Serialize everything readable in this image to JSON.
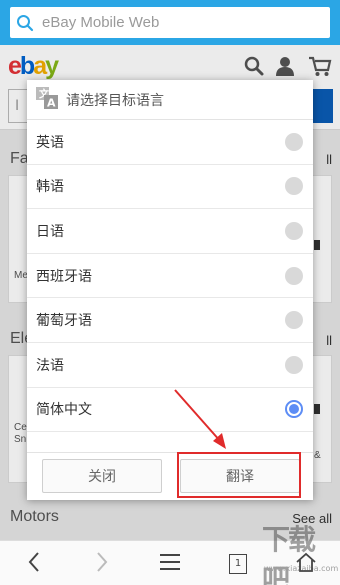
{
  "browser": {
    "url_text": "eBay Mobile Web",
    "accent_color": "#2ba6e5"
  },
  "ebay": {
    "logo_letters": [
      "e",
      "b",
      "a",
      "y"
    ],
    "search_placeholder": "I"
  },
  "background": {
    "sections": [
      "Fa",
      "Ele",
      "Motors"
    ],
    "see_all": [
      "ll",
      "ll",
      "See all"
    ],
    "card_labels": [
      "Me",
      "Ce",
      "Sn",
      "&"
    ]
  },
  "dialog": {
    "title": "请选择目标语言",
    "languages": [
      {
        "label": "英语",
        "selected": false
      },
      {
        "label": "韩语",
        "selected": false
      },
      {
        "label": "日语",
        "selected": false
      },
      {
        "label": "西班牙语",
        "selected": false
      },
      {
        "label": "葡萄牙语",
        "selected": false
      },
      {
        "label": "法语",
        "selected": false
      },
      {
        "label": "简体中文",
        "selected": true
      }
    ],
    "close_label": "关闭",
    "translate_label": "翻译"
  },
  "bottom_nav": {
    "tab_count": "1"
  },
  "watermark": {
    "text": "下载吧",
    "url": "www.xiazaiba.com"
  }
}
